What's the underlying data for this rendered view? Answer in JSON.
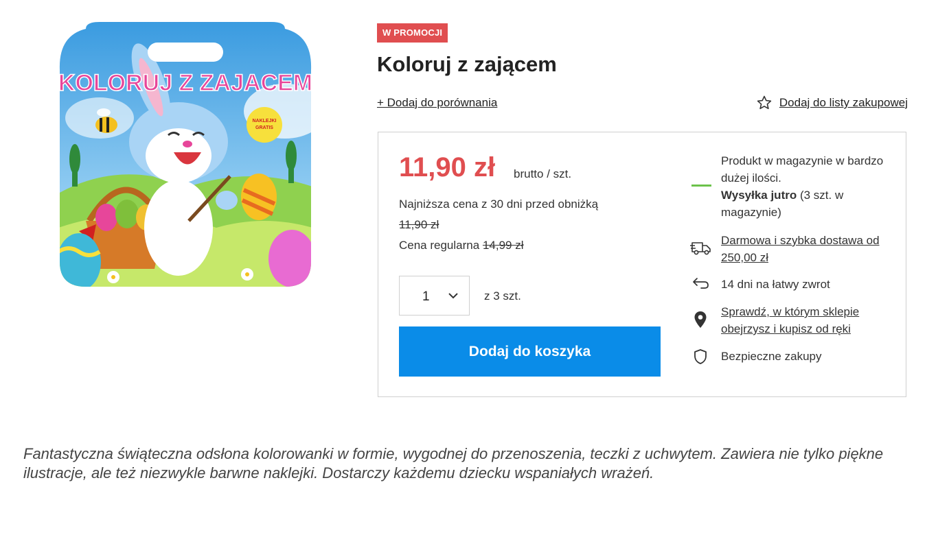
{
  "product": {
    "promo_badge": "W PROMOCJI",
    "title": "Koloruj z zającem",
    "image_title_art": "KOLORUJ Z ZAJACEM",
    "image_sticker": "NAKLEJKI GRATIS"
  },
  "actions": {
    "compare": "+ Dodaj do porównania",
    "shopping_list": "Dodaj do listy zakupowej"
  },
  "pricing": {
    "price": "11,90 zł",
    "unit": "brutto / szt.",
    "lowest_label": "Najniższa cena z 30 dni przed obniżką",
    "lowest_value": "11,90 zł",
    "regular_label": "Cena regularna",
    "regular_value": "14,99 zł"
  },
  "quantity": {
    "selected": "1",
    "stock": "z 3 szt."
  },
  "cart": {
    "button": "Dodaj do koszyka"
  },
  "info": {
    "stock_line1": "Produkt w magazynie w bardzo dużej ilości.",
    "shipping_bold": "Wysyłka jutro",
    "shipping_rest": "(3 szt. w magazynie)",
    "delivery": "Darmowa i szybka dostawa od 250,00 zł",
    "returns": "14 dni na łatwy zwrot",
    "store_check": "Sprawdź, w którym sklepie obejrzysz i kupisz od ręki",
    "secure": "Bezpieczne zakupy"
  },
  "description": "Fantastyczna świąteczna odsłona kolorowanki w formie, wygodnej do przenoszenia, teczki z uchwytem. Zawiera nie tylko piękne ilustracje, ale też niezwykle barwne naklejki. Dostarczy każdemu dziecku wspaniałych wrażeń.",
  "colors": {
    "promo": "#e04e50",
    "price": "#e04e50",
    "cart_button": "#0a8ce8",
    "stock_indicator": "#6cc24a",
    "border": "#cfcfcf"
  },
  "icons": [
    "star-icon",
    "chevron-down-icon",
    "truck-icon",
    "return-arrow-icon",
    "map-pin-icon",
    "shield-icon"
  ]
}
